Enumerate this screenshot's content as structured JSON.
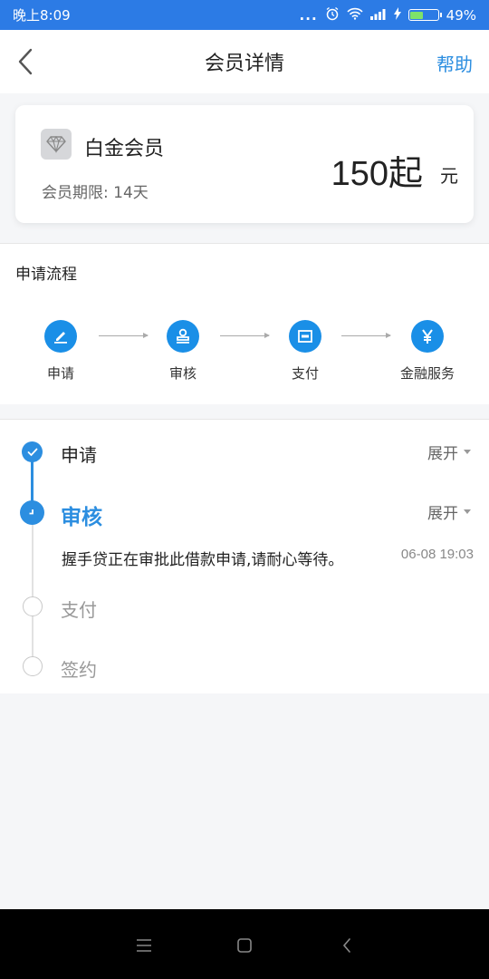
{
  "status_bar": {
    "time": "晚上8:09",
    "dots": "...",
    "battery": "49%"
  },
  "nav": {
    "title": "会员详情",
    "help": "帮助"
  },
  "member": {
    "tier": "白金会员",
    "term": "会员期限: 14天",
    "price": "150起",
    "unit": "元"
  },
  "process": {
    "title": "申请流程",
    "steps": [
      {
        "label": "申请",
        "icon": "pen-icon"
      },
      {
        "label": "审核",
        "icon": "stamp-icon"
      },
      {
        "label": "支付",
        "icon": "card-icon"
      },
      {
        "label": "金融服务",
        "icon": "yen-icon"
      }
    ]
  },
  "timeline": {
    "items": [
      {
        "title": "申请",
        "status": "done",
        "expand": "展开"
      },
      {
        "title": "审核",
        "status": "current",
        "expand": "展开",
        "desc": "握手贷正在审批此借款申请,请耐心等待。",
        "time": "06-08 19:03"
      },
      {
        "title": "支付",
        "status": "pending"
      },
      {
        "title": "签约",
        "status": "pending"
      }
    ]
  },
  "colors": {
    "accent": "#2c8ee0",
    "status_bar": "#2c7be5",
    "step_blue": "#1a8fe7"
  }
}
